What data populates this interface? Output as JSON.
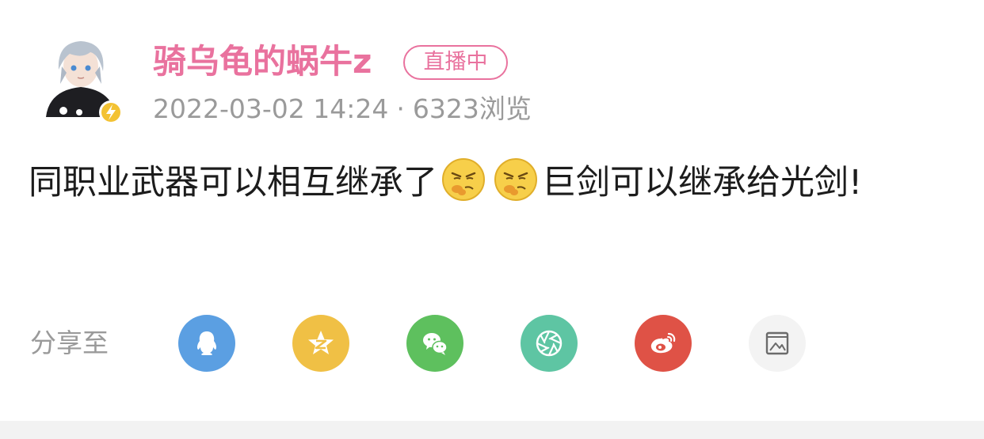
{
  "author": {
    "name": "骑乌龟的蜗牛z",
    "badge": "直播中",
    "date": "2022-03-02 14:24",
    "separator": "·",
    "views": "6323浏览"
  },
  "post": {
    "text_before": "同职业武器可以相互继承了",
    "text_after": "巨剑可以继承给光剑!",
    "emojis": [
      "fuming-emoji",
      "fuming-emoji"
    ]
  },
  "share": {
    "label": "分享至",
    "targets": [
      {
        "name": "qq",
        "color": "#5b9fe2"
      },
      {
        "name": "qzone",
        "color": "#f0c045"
      },
      {
        "name": "wechat",
        "color": "#5ec05e"
      },
      {
        "name": "moments",
        "color": "#5ec5a3"
      },
      {
        "name": "weibo",
        "color": "#df5246"
      },
      {
        "name": "save-image",
        "color": "#f3f3f3"
      }
    ]
  },
  "colors": {
    "accent": "#e9729e",
    "meta_text": "#9a9a9a",
    "body_text": "#1c1c1c"
  }
}
